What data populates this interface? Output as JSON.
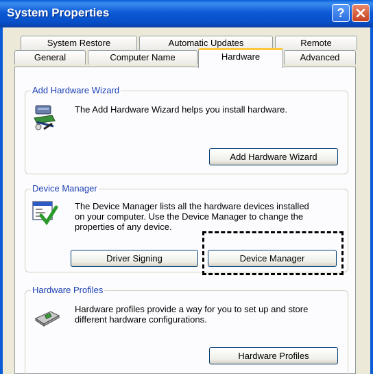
{
  "window": {
    "title": "System Properties"
  },
  "titlebar_buttons": {
    "help": "?",
    "close_icon": "close-icon"
  },
  "tabs": {
    "row1": [
      "System Restore",
      "Automatic Updates",
      "Remote"
    ],
    "row2": [
      "General",
      "Computer Name",
      "Hardware",
      "Advanced"
    ],
    "active": "Hardware"
  },
  "add_hardware": {
    "legend": "Add Hardware Wizard",
    "description": "The Add Hardware Wizard helps you install hardware.",
    "button_label": "Add Hardware Wizard",
    "icon": "add-hardware-wizard-icon"
  },
  "device_manager": {
    "legend": "Device Manager",
    "description_lines": [
      "The Device Manager lists all the hardware devices installed",
      "on your computer. Use the Device Manager to change the",
      "properties of any device."
    ],
    "driver_signing_label": "Driver Signing",
    "button_label": "Device Manager",
    "icon": "device-manager-icon"
  },
  "hardware_profiles": {
    "legend": "Hardware Profiles",
    "description_lines": [
      "Hardware profiles provide a way for you to set up and store",
      "different hardware configurations."
    ],
    "button_label": "Hardware Profiles",
    "icon": "hardware-profiles-icon"
  },
  "colors": {
    "titlebar": "#0c5ad6",
    "active_tab_accent": "#ffc83c",
    "group_legend": "#1b3fb0"
  }
}
